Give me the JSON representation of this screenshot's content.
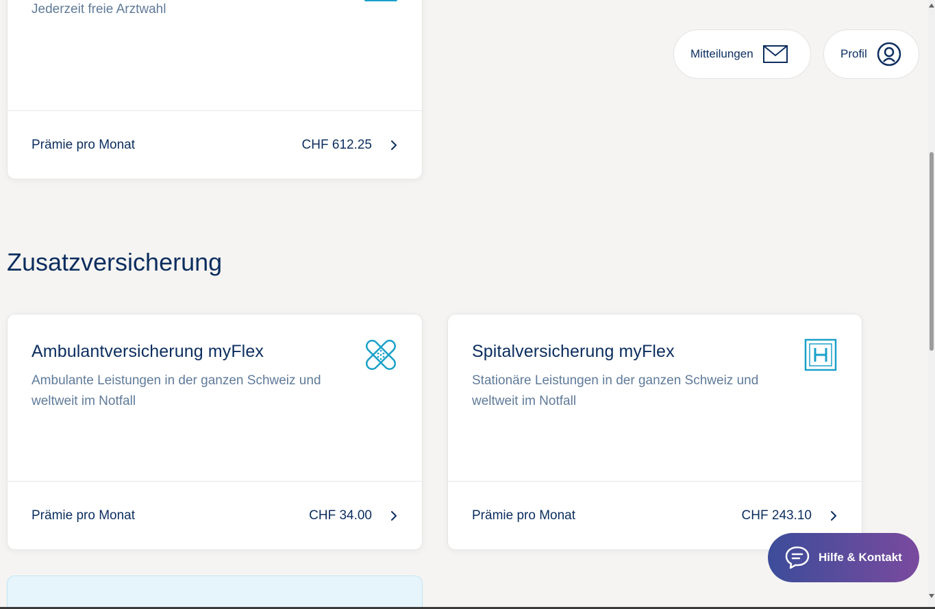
{
  "header": {
    "messages_label": "Mitteilungen",
    "profile_label": "Profil"
  },
  "basic_card": {
    "description": "Jederzeit freie Arztwahl",
    "premium_label": "Prämie pro Monat",
    "premium_value": "CHF 612.25"
  },
  "section": {
    "title": "Zusatzversicherung"
  },
  "cards": [
    {
      "title": "Ambulantversicherung myFlex",
      "description": "Ambulante Leistungen in der ganzen Schweiz und weltweit im Notfall",
      "icon": "bandage-icon",
      "premium_label": "Prämie pro Monat",
      "premium_value": "CHF 34.00"
    },
    {
      "title": "Spitalversicherung myFlex",
      "description": "Stationäre Leistungen in der ganzen Schweiz und weltweit im Notfall",
      "icon": "hospital-icon",
      "premium_label": "Prämie pro Monat",
      "premium_value": "CHF 243.10"
    }
  ],
  "help": {
    "label": "Hilfe & Kontakt"
  },
  "colors": {
    "primary_text": "#0b2d5e",
    "secondary_text": "#5f7a99",
    "icon_teal": "#1aa0c8",
    "help_gradient_start": "#3c4d9a",
    "help_gradient_end": "#7a4a9e"
  }
}
